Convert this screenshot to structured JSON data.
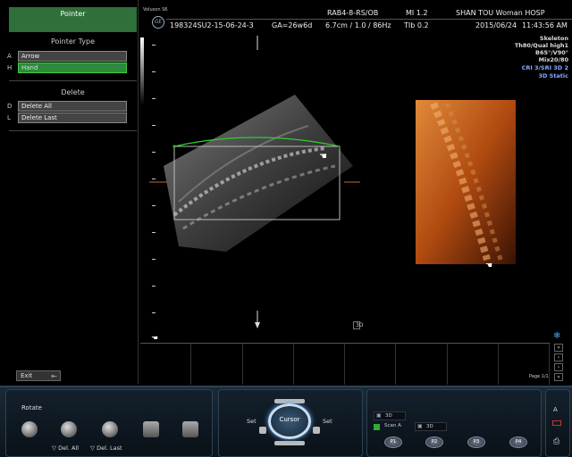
{
  "left_panel": {
    "header": "Pointer",
    "pointer_type_title": "Pointer Type",
    "pointer_options": [
      {
        "key": "A",
        "label": "Arrow",
        "selected": false
      },
      {
        "key": "H",
        "label": "Hand",
        "selected": true
      }
    ],
    "delete_title": "Delete",
    "delete_options": [
      {
        "key": "D",
        "label": "Delete All"
      },
      {
        "key": "L",
        "label": "Delete Last"
      }
    ],
    "exit_label": "Exit"
  },
  "top_bar": {
    "brand": "Voluson S6",
    "patient_id": "198324SU2-15-06-24-3",
    "ga": "GA=26w6d",
    "probe": "RAB4-8-RS/OB",
    "mi": "MI  1.2",
    "hospital": "SHAN TOU Woman HOSP",
    "depth": "6.7cm / 1.0 / 86Hz",
    "tib": "TIb  0.2",
    "date": "2015/06/24",
    "time": "11:43:56 AM"
  },
  "right_info": {
    "lines": [
      "Skeleton",
      "Th80/Qual high1",
      "B65°/V90°",
      "Mix20/80"
    ],
    "blue_lines": [
      "CRI 3/SRI 3D 2",
      "3D Static"
    ]
  },
  "viewport": {
    "render_mode_label": "3D"
  },
  "strip": {
    "page_label": "Page 1/1"
  },
  "console": {
    "rotate_label": "Rotate",
    "del_all": "▽ Del. All",
    "del_last": "▽ Del. Last",
    "cursor_label": "Cursor",
    "set_left": "Set",
    "set_right": "Set",
    "field1": "3D",
    "field2": "3D",
    "scan_label": "Scan A",
    "p_buttons": [
      "P1",
      "P2",
      "P3",
      "P4"
    ],
    "a_label": "A"
  },
  "colors": {
    "accent_green": "#2f6f3a",
    "selected_green": "#2b8b3a",
    "info_blue": "#8aa8ff"
  }
}
